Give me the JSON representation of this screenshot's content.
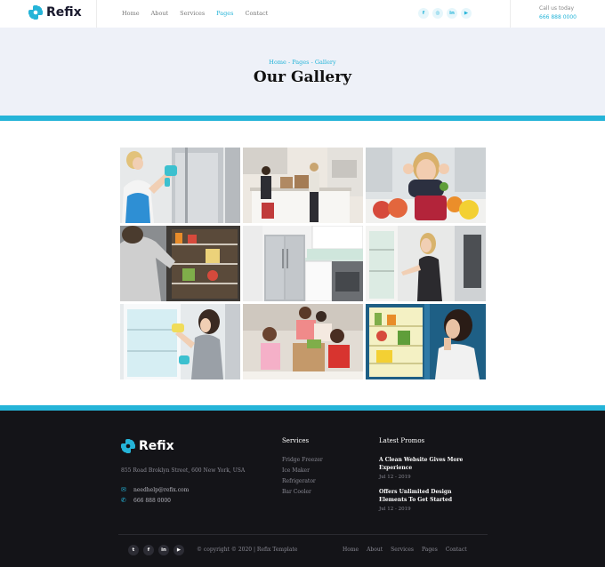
{
  "brand": {
    "name": "Refix",
    "accent": "#25b4d8"
  },
  "nav": [
    {
      "label": "Home",
      "active": false
    },
    {
      "label": "About",
      "active": false
    },
    {
      "label": "Services",
      "active": false
    },
    {
      "label": "Pages",
      "active": true
    },
    {
      "label": "Contact",
      "active": false
    }
  ],
  "social": [
    "facebook-icon",
    "instagram-icon",
    "linkedin-icon",
    "youtube-icon"
  ],
  "contact": {
    "label": "Call us today",
    "phone": "666 888 0000"
  },
  "hero": {
    "breadcrumb": "Home - Pages - Gallery",
    "title": "Our Gallery"
  },
  "gallery": [
    "woman-cleaning-fridge-photo",
    "family-unpacking-groceries-photo",
    "woman-with-fruit-photo",
    "man-opening-fridge-photo",
    "stainless-fridge-kitchen-photo",
    "woman-at-fridge-photo",
    "woman-wiping-fridge-photo",
    "family-with-groceries-photo",
    "woman-eating-at-fridge-photo"
  ],
  "footer": {
    "address": "855 Road Broklyn Street, 600 New York, USA",
    "email": "needhelp@refix.com",
    "phone": "666 888 0000",
    "services_heading": "Services",
    "services": [
      "Fridge Freezer",
      "Ice Maker",
      "Refrigerator",
      "Bar Cooler"
    ],
    "promos_heading": "Latest Promos",
    "promos": [
      {
        "title": "A Clean Website Gives More Experience",
        "date": "Jul 12 - 2019"
      },
      {
        "title": "Offers Unlimited Design Elements To Get Started",
        "date": "Jul 12 - 2019"
      }
    ],
    "copyright": "© copyright © 2020 | Refix Template",
    "social": [
      "twitter-icon",
      "facebook-icon",
      "linkedin-icon",
      "youtube-icon"
    ],
    "nav": [
      "Home",
      "About",
      "Services",
      "Pages",
      "Contact"
    ]
  }
}
